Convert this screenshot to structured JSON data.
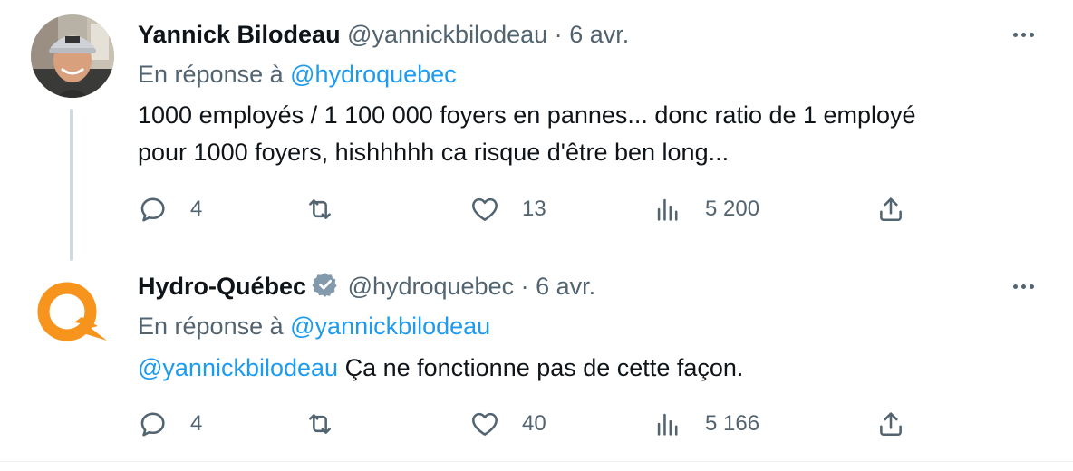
{
  "tweets": [
    {
      "name": "Yannick Bilodeau",
      "handle": "@yannickbilodeau",
      "separator": "·",
      "date": "6 avr.",
      "reply_prefix": "En réponse à",
      "reply_to": "@hydroquebec",
      "text_lines": [
        "1000 employés / 1 100 000 foyers en pannes...  donc ratio de 1 employé",
        "pour 1000 foyers, hishhhhh ca risque d'être ben long..."
      ],
      "replies": "4",
      "likes": "13",
      "views": "5 200"
    },
    {
      "name": "Hydro-Québec",
      "handle": "@hydroquebec",
      "separator": "·",
      "date": "6 avr.",
      "reply_prefix": "En réponse à",
      "reply_to": "@yannickbilodeau",
      "mention": "@yannickbilodeau",
      "text": "Ça ne fonctionne pas de cette façon.",
      "replies": "4",
      "likes": "40",
      "views": "5 166"
    }
  ],
  "icons": {
    "reply": "reply-icon",
    "retweet": "retweet-icon",
    "like": "heart-icon",
    "views": "bar-chart-icon",
    "share": "share-icon",
    "more": "more-dots-icon",
    "verified": "verified-badge-icon"
  },
  "colors": {
    "link": "#1d9bf0",
    "muted": "#536471",
    "brand_orange": "#f7941d",
    "thread_line": "#cfd9de"
  }
}
